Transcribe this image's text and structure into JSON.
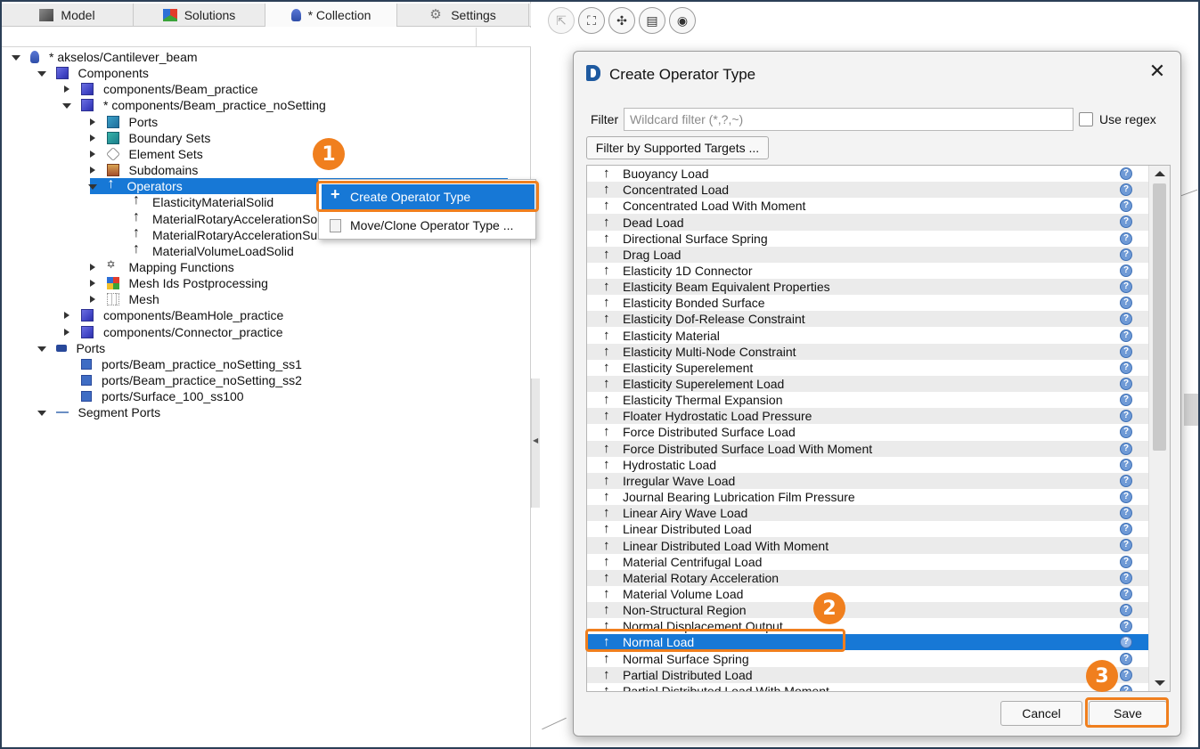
{
  "tabs": [
    {
      "label": "Model",
      "icon": "model-icon",
      "active": false
    },
    {
      "label": "Solutions",
      "icon": "solutions-icon",
      "active": false
    },
    {
      "label": "* Collection",
      "icon": "collection-icon",
      "active": true
    },
    {
      "label": "Settings",
      "icon": "gear-icon",
      "active": false
    }
  ],
  "tree": [
    {
      "label": "* akselos/Cantilever_beam",
      "depth": 0,
      "toggle": "open",
      "icon": "collection-root-icon"
    },
    {
      "label": "Components",
      "depth": 1,
      "toggle": "open",
      "icon": "cube-icon"
    },
    {
      "label": "components/Beam_practice",
      "depth": 2,
      "toggle": "closed",
      "icon": "cube-icon"
    },
    {
      "label": "* components/Beam_practice_noSetting",
      "depth": 2,
      "toggle": "open",
      "icon": "cube-icon"
    },
    {
      "label": "Ports",
      "depth": 3,
      "toggle": "closed",
      "icon": "ports-icon"
    },
    {
      "label": "Boundary Sets",
      "depth": 3,
      "toggle": "closed",
      "icon": "boundary-set-icon"
    },
    {
      "label": "Element Sets",
      "depth": 3,
      "toggle": "closed",
      "icon": "element-set-icon"
    },
    {
      "label": "Subdomains",
      "depth": 3,
      "toggle": "closed",
      "icon": "subdomain-icon"
    },
    {
      "label": "Operators",
      "depth": 3,
      "toggle": "open",
      "icon": "operator-icon",
      "selected": true
    },
    {
      "label": "ElasticityMaterialSolid",
      "depth": 4,
      "toggle": "none",
      "icon": "operator-icon"
    },
    {
      "label": "MaterialRotaryAccelerationSo",
      "depth": 4,
      "toggle": "none",
      "icon": "operator-icon"
    },
    {
      "label": "MaterialRotaryAccelerationSu",
      "depth": 4,
      "toggle": "none",
      "icon": "operator-icon"
    },
    {
      "label": "MaterialVolumeLoadSolid",
      "depth": 4,
      "toggle": "none",
      "icon": "operator-icon"
    },
    {
      "label": "Mapping Functions",
      "depth": 3,
      "toggle": "closed",
      "icon": "mapping-icon"
    },
    {
      "label": "Mesh Ids Postprocessing",
      "depth": 3,
      "toggle": "closed",
      "icon": "mesh-ids-icon"
    },
    {
      "label": "Mesh",
      "depth": 3,
      "toggle": "closed",
      "icon": "mesh-icon"
    },
    {
      "label": "components/BeamHole_practice",
      "depth": 2,
      "toggle": "closed",
      "icon": "cube-icon"
    },
    {
      "label": "components/Connector_practice",
      "depth": 2,
      "toggle": "closed",
      "icon": "cube-icon"
    },
    {
      "label": "Ports",
      "depth": 1,
      "toggle": "open",
      "icon": "ports-root-icon"
    },
    {
      "label": "ports/Beam_practice_noSetting_ss1",
      "depth": 2,
      "toggle": "none",
      "icon": "port-square-icon"
    },
    {
      "label": "ports/Beam_practice_noSetting_ss2",
      "depth": 2,
      "toggle": "none",
      "icon": "port-square-icon"
    },
    {
      "label": "ports/Surface_100_ss100",
      "depth": 2,
      "toggle": "none",
      "icon": "port-square-icon"
    },
    {
      "label": "Segment Ports",
      "depth": 1,
      "toggle": "open",
      "icon": "segment-line-icon"
    }
  ],
  "context_menu": {
    "create_label": "Create Operator Type",
    "move_label": "Move/Clone Operator Type ..."
  },
  "dialog": {
    "title": "Create Operator Type",
    "close_glyph": "✕",
    "filter_label": "Filter",
    "filter_value": "",
    "filter_placeholder": "Wildcard filter (*,?,~)",
    "use_regex_label": "Use regex",
    "use_regex_checked": false,
    "targets_button": "Filter by Supported Targets ...",
    "items": [
      "Buoyancy Load",
      "Concentrated Load",
      "Concentrated Load With Moment",
      "Dead Load",
      "Directional Surface Spring",
      "Drag Load",
      "Elasticity 1D Connector",
      "Elasticity Beam Equivalent Properties",
      "Elasticity Bonded Surface",
      "Elasticity Dof-Release Constraint",
      "Elasticity Material",
      "Elasticity Multi-Node Constraint",
      "Elasticity Superelement",
      "Elasticity Superelement Load",
      "Elasticity Thermal Expansion",
      "Floater Hydrostatic Load Pressure",
      "Force Distributed Surface Load",
      "Force Distributed Surface Load With Moment",
      "Hydrostatic Load",
      "Irregular Wave Load",
      "Journal Bearing Lubrication Film Pressure",
      "Linear Airy Wave Load",
      "Linear Distributed Load",
      "Linear Distributed Load With Moment",
      "Material Centrifugal Load",
      "Material Rotary Acceleration",
      "Material Volume Load",
      "Non-Structural Region",
      "Normal Displacement Output",
      "Normal Load",
      "Normal Surface Spring",
      "Partial Distributed Load",
      "Partial Distributed Load With Moment"
    ],
    "selected_item": "Normal Load",
    "cancel_label": "Cancel",
    "save_label": "Save"
  },
  "annotations": {
    "step1": "1",
    "step2": "2",
    "step3": "3"
  },
  "colors": {
    "selection": "#1778d6",
    "annotation": "#f07f1e",
    "frame": "#2b3f57"
  }
}
